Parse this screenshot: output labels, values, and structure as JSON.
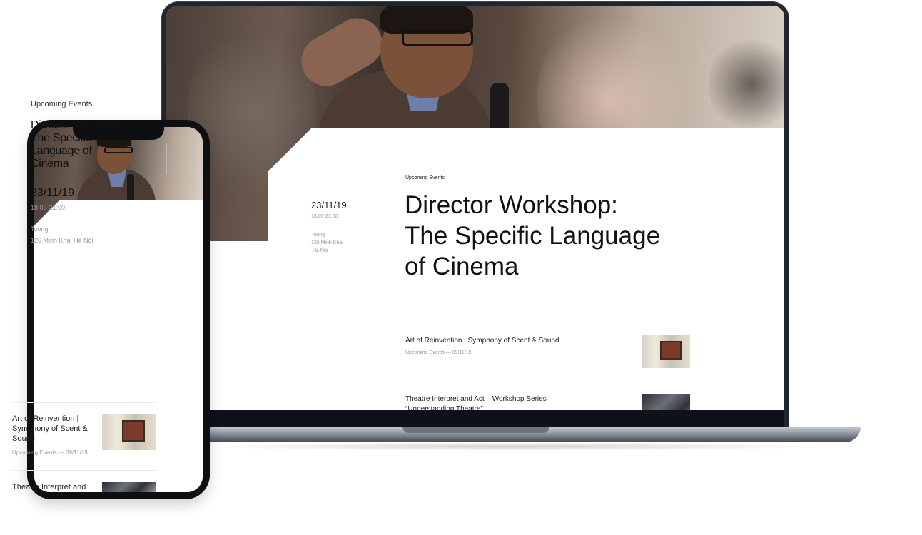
{
  "laptop": {
    "eyebrow": "Upcoming Events",
    "title_lines": [
      "Director Workshop:",
      "The Specific Language",
      "of Cinema"
    ],
    "date": "23/11/19",
    "time": "18:00-21:00",
    "venue_lines": [
      "Toong",
      "126 Minh Khai",
      "Hà Nội"
    ],
    "items": [
      {
        "title_lines": [
          "Art of Reinvention | Symphony of Scent & Sound"
        ],
        "meta": "Upcoming Events — 09/11/19",
        "thumb": "gallery-photo"
      },
      {
        "title_lines": [
          "Theatre Interpret and Act – Workshop Series",
          "“Understanding Theatre”"
        ],
        "meta": "",
        "thumb": "workshop-photo"
      }
    ]
  },
  "phone": {
    "eyebrow": "Upcoming Events",
    "title_lines": [
      "Director Workshop:",
      "The Specific",
      "Language of",
      "Cinema"
    ],
    "date": "23/11/19",
    "time": "18:00-21:00",
    "venue_lines": [
      "Toong",
      "126 Minh Khai Hà Nội"
    ],
    "items": [
      {
        "title_lines": [
          "Art of Reinvention |",
          "Symphony of Scent &",
          "Sound"
        ],
        "meta": "Upcoming Events — 09/11/19",
        "thumb": "gallery-photo"
      },
      {
        "title_lines": [
          "Theatre Interpret and"
        ],
        "meta": "",
        "thumb": "workshop-photo"
      }
    ]
  },
  "colors": {
    "device_frame": "#1f2630",
    "phone_frame": "#0e0f12",
    "text_primary": "#111111",
    "text_muted": "#999999"
  }
}
